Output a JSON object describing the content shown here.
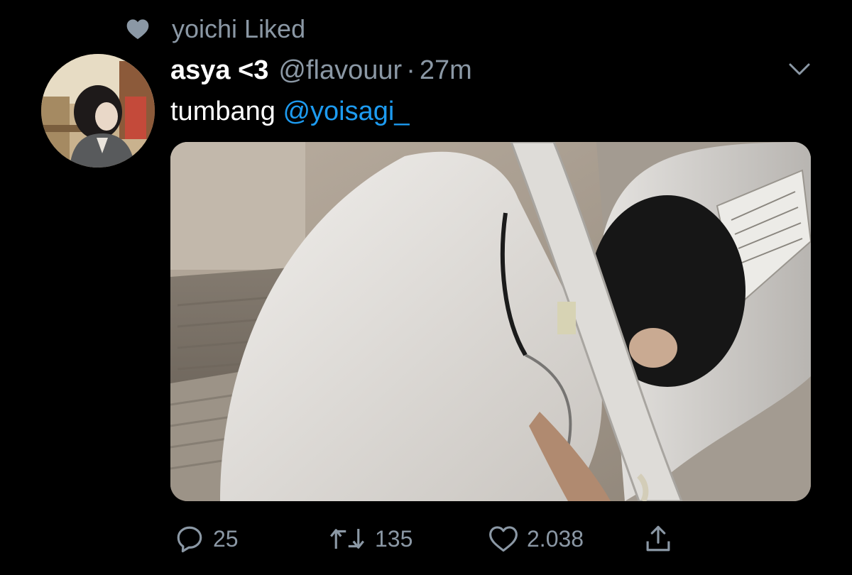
{
  "social_context": {
    "text": "yoichi Liked",
    "icon": "heart-filled-icon"
  },
  "tweet": {
    "display_name": "asya <3",
    "handle": "@flavouur",
    "separator": "·",
    "time": "27m",
    "text_plain": "tumbang ",
    "mention": "@yoisagi_",
    "more_icon": "chevron-down-icon"
  },
  "actions": {
    "replies": "25",
    "retweets": "135",
    "likes": "2.038",
    "reply_icon": "reply-icon",
    "retweet_icon": "retweet-icon",
    "like_icon": "heart-outline-icon",
    "share_icon": "share-icon"
  },
  "colors": {
    "background": "#000000",
    "secondary_text": "#8b98a5",
    "primary_text": "#ffffff",
    "link": "#1d9bf0"
  }
}
